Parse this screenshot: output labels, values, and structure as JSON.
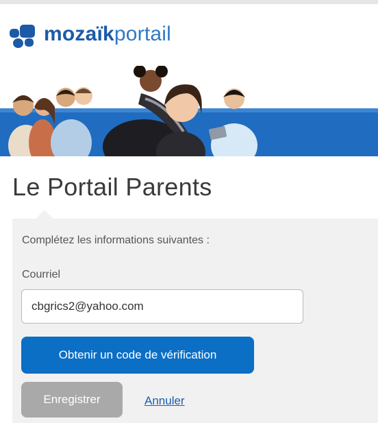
{
  "header": {
    "logo_bold": "mozaïk",
    "logo_light": "portail",
    "logo_icon": "mozaik-logo-icon"
  },
  "banner": {
    "image": "family-banner-photo"
  },
  "page": {
    "title": "Le Portail Parents"
  },
  "form": {
    "instructions": "Complétez les informations suivantes :",
    "email_label": "Courriel",
    "email_value": "cbgrics2@yahoo.com",
    "verify_button": "Obtenir un code de vérification",
    "save_button": "Enregistrer",
    "cancel_link": "Annuler"
  },
  "colors": {
    "brand": "#1c5aa8",
    "primary_button": "#0b6fc6",
    "disabled_button": "#a9a9a9",
    "link": "#1a5db0",
    "panel": "#f1f1f1"
  }
}
